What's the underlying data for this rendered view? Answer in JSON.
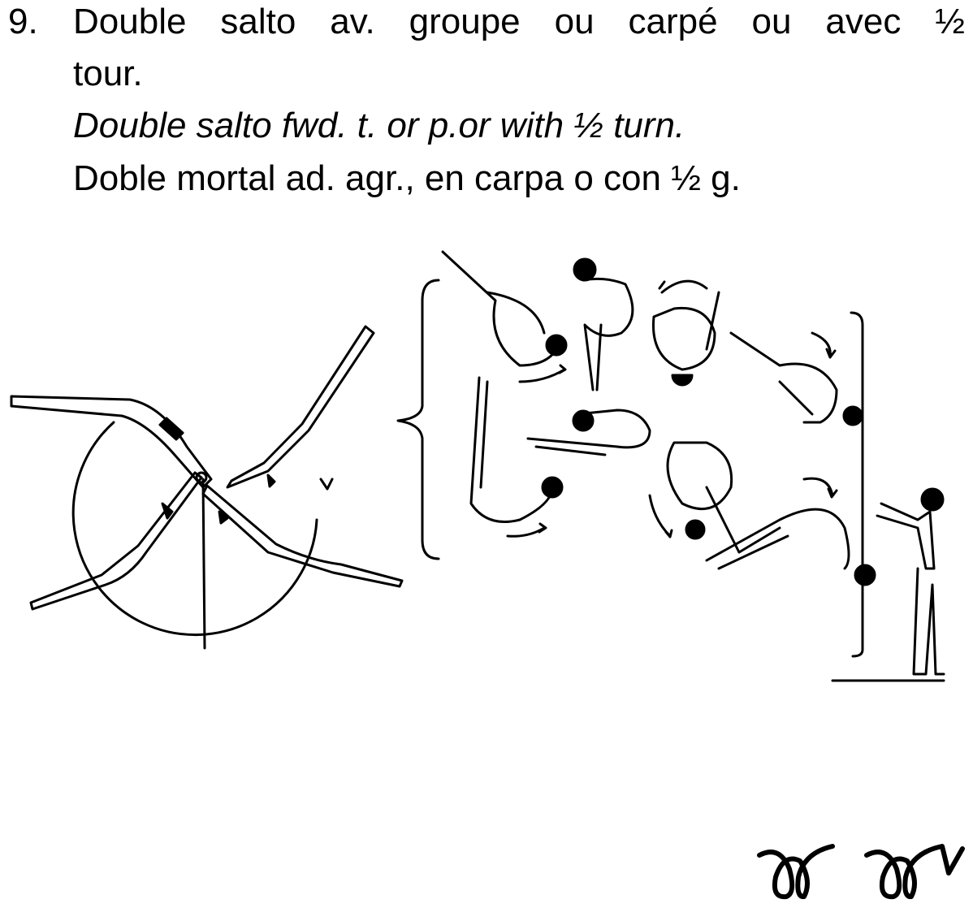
{
  "element": {
    "number": "9.",
    "french_words": [
      "Double",
      "salto",
      "av.",
      "groupe",
      "ou",
      "carpé",
      "ou",
      "avec",
      "½"
    ],
    "french_cont": "tour.",
    "english": "Double salto fwd. t. or p.or with ½ turn.",
    "spanish": "Doble mortal ad. agr., en carpa o con ½ g."
  },
  "illustration": {
    "icons": [
      "giant-swing-figure",
      "bracket-icon",
      "tucked-salto-figures",
      "piked-salto-figures",
      "landing-gymnast-figure",
      "salto-notation-symbol",
      "salto-half-turn-notation-symbol"
    ]
  }
}
